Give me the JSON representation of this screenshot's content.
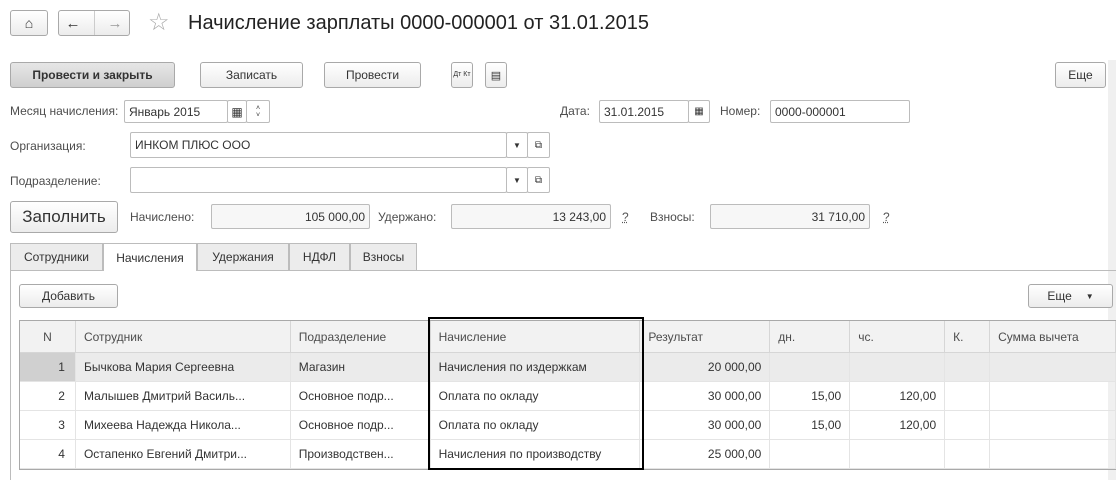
{
  "title": "Начисление зарплаты 0000-000001 от 31.01.2015",
  "toolbar": {
    "post_close": "Провести и закрыть",
    "save": "Записать",
    "post": "Провести",
    "dtkt": "Дт Кт",
    "more": "Еще"
  },
  "form": {
    "month_label": "Месяц начисления:",
    "month_value": "Январь 2015",
    "date_label": "Дата:",
    "date_value": "31.01.2015",
    "number_label": "Номер:",
    "number_value": "0000-000001",
    "org_label": "Организация:",
    "org_value": "ИНКОМ ПЛЮС ООО",
    "dept_label": "Подразделение:",
    "dept_value": ""
  },
  "totals": {
    "fill": "Заполнить",
    "accrued_label": "Начислено:",
    "accrued": "105 000,00",
    "withheld_label": "Удержано:",
    "withheld": "13 243,00",
    "contrib_label": "Взносы:",
    "contrib": "31 710,00",
    "help": "?"
  },
  "tabs": [
    "Сотрудники",
    "Начисления",
    "Удержания",
    "НДФЛ",
    "Взносы"
  ],
  "table_toolbar": {
    "add": "Добавить",
    "more": "Еще"
  },
  "columns": [
    "N",
    "Сотрудник",
    "Подразделение",
    "Начисление",
    "Результат",
    "дн.",
    "чс.",
    "К.",
    "Сумма вычета"
  ],
  "rows": [
    [
      "1",
      "Бычкова Мария Сергеевна",
      "Магазин",
      "Начисления по издержкам",
      "20 000,00",
      "",
      "",
      "",
      ""
    ],
    [
      "2",
      "Малышев Дмитрий Василь...",
      "Основное подр...",
      "Оплата по окладу",
      "30 000,00",
      "15,00",
      "120,00",
      "",
      ""
    ],
    [
      "3",
      "Михеева Надежда Никола...",
      "Основное подр...",
      "Оплата по окладу",
      "30 000,00",
      "15,00",
      "120,00",
      "",
      ""
    ],
    [
      "4",
      "Остапенко Евгений Дмитри...",
      "Производствен...",
      "Начисления по производству",
      "25 000,00",
      "",
      "",
      "",
      ""
    ]
  ]
}
